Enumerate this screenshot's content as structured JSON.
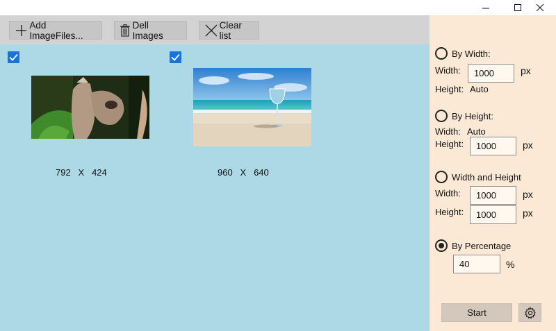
{
  "window": {
    "minimize_glyph": "—",
    "maximize_glyph": "☐",
    "close_glyph": "✕"
  },
  "toolbar": {
    "add_label": "Add ImageFiles...",
    "delete_label": "Dell Images",
    "clear_label": "Clear list"
  },
  "images": [
    {
      "checked": true,
      "width": "792",
      "height": "424",
      "sep": "X"
    },
    {
      "checked": true,
      "width": "960",
      "height": "640",
      "sep": "X"
    }
  ],
  "resize": {
    "by_width": {
      "label": "By Width:",
      "width_label": "Width:",
      "width_value": "1000",
      "width_unit": "px",
      "height_label": "Height:",
      "height_value": "Auto",
      "selected": false
    },
    "by_height": {
      "label": "By Height:",
      "width_label": "Width:",
      "width_value": "Auto",
      "height_label": "Height:",
      "height_value": "1000",
      "height_unit": "px",
      "selected": false
    },
    "width_and_height": {
      "label": "Width and Height",
      "width_label": "Width:",
      "width_value": "1000",
      "width_unit": "px",
      "height_label": "Height:",
      "height_value": "1000",
      "height_unit": "px",
      "selected": false
    },
    "by_percentage": {
      "label": "By Percentage",
      "value": "40",
      "unit": "%",
      "selected": true
    }
  },
  "actions": {
    "start_label": "Start",
    "settings_icon": "gear-icon"
  },
  "colors": {
    "left_pane_bg": "#add8e6",
    "toolbar_bg": "#d3d3d3",
    "right_pane_bg": "#fbe9d6",
    "check_accent": "#1a73d9"
  }
}
